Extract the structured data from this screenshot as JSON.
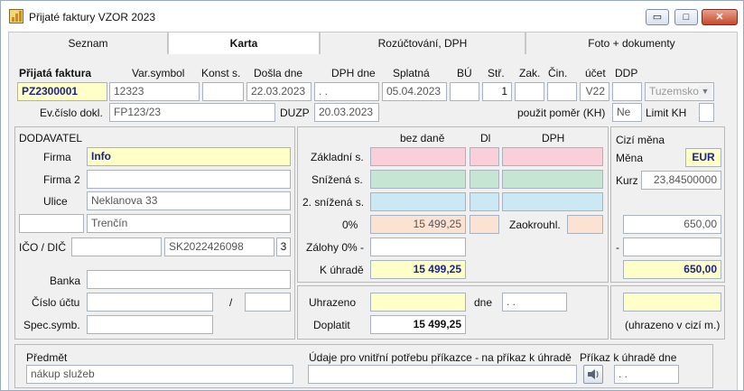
{
  "window": {
    "title": "Přijaté faktury VZOR 2023",
    "minimize": "▭",
    "maximize": "□",
    "close": "✕"
  },
  "tabs": [
    {
      "label": "Seznam"
    },
    {
      "label": "Karta"
    },
    {
      "label": "Rozúčtování, DPH"
    },
    {
      "label": "Foto + dokumenty"
    }
  ],
  "header": {
    "prijata_faktura_label": "Přijatá faktura",
    "prijata_faktura_value": "PZ2300001",
    "varsymbol_label": "Var.symbol",
    "varsymbol_value": "12323",
    "konst_label": "Konst s.",
    "konst_value": "",
    "dosla_label": "Došla dne",
    "dosla_value": "22.03.2023",
    "dphdne_label": "DPH dne",
    "dphdne_value": ". .",
    "splatna_label": "Splatná",
    "splatna_value": "05.04.2023",
    "bu_label": "BÚ",
    "bu_value": "",
    "str_label": "Stř.",
    "str_value": "1",
    "zak_label": "Zak.",
    "zak_value": "",
    "cin_label": "Čin.",
    "cin_value": "",
    "ucet_label": "účet",
    "ucet_value": "V22",
    "ddp_label": "DDP",
    "ddp_value": "",
    "ddp_select": "Tuzemsko",
    "evcislo_label": "Ev.číslo dokl.",
    "evcislo_value": "FP123/23",
    "duzp_label": "DUZP",
    "duzp_value": "20.03.2023",
    "pomer_label": "použit poměr (KH)",
    "pomer_value": "Ne",
    "limit_label": "Limit KH",
    "limit_value": ""
  },
  "dodavatel": {
    "title": "DODAVATEL",
    "firma_label": "Firma",
    "firma_value": "Info",
    "firma2_label": "Firma 2",
    "firma2_value": "",
    "ulice_label": "Ulice",
    "ulice_value": "Neklanova  33",
    "psc_value": "",
    "mesto_value": "Trenčín",
    "ico_label": "IČO / DIČ",
    "ico_value": "",
    "dic_value": "SK2022426098",
    "dic_suffix": "3",
    "banka_label": "Banka",
    "banka_value": "",
    "cislo_uctu_label": "Číslo účtu",
    "cislo_uctu_value": "",
    "kod_banky_sep": "/",
    "kod_banky_value": "",
    "spec_label": "Spec.symb.",
    "spec_value": ""
  },
  "amounts": {
    "col_bezdane": "bez daně",
    "col_dl": "Dl",
    "col_dph": "DPH",
    "zakladni_label": "Základní s.",
    "snizena_label": "Snížená s.",
    "snizena2_label": "2. snížená s.",
    "nula_label": "0%",
    "nula_value": "15 499,25",
    "zaokrouhl_label": "Zaokrouhl.",
    "zalohy_label": "Zálohy 0% -",
    "k_uhrade_label": "K úhradě",
    "k_uhrade_value": "15 499,25"
  },
  "mena": {
    "title": "Cizí měna",
    "mena_label": "Měna",
    "mena_value": "EUR",
    "kurz_label": "Kurz",
    "kurz_value": "23,84500000",
    "nula_value": "650,00",
    "minus_label": "-",
    "k_uhrade_value": "650,00",
    "uhrazeno_note": "(uhrazeno v cizí m.)"
  },
  "platba": {
    "uhrazeno_label": "Uhrazeno",
    "uhrazeno_value": "",
    "dne_label": "dne",
    "dne_value": ". .",
    "doplatit_label": "Doplatit",
    "doplatit_value": "15 499,25"
  },
  "bottom": {
    "predmet_label": "Předmět",
    "predmet_value": "nákup služeb",
    "udaje_label": "Údaje pro vnitřní potřebu příkazce - na příkaz k úhradě",
    "udaje_value": "",
    "prikaz_label": "Příkaz k úhradě dne",
    "prikaz_value": ". ."
  }
}
